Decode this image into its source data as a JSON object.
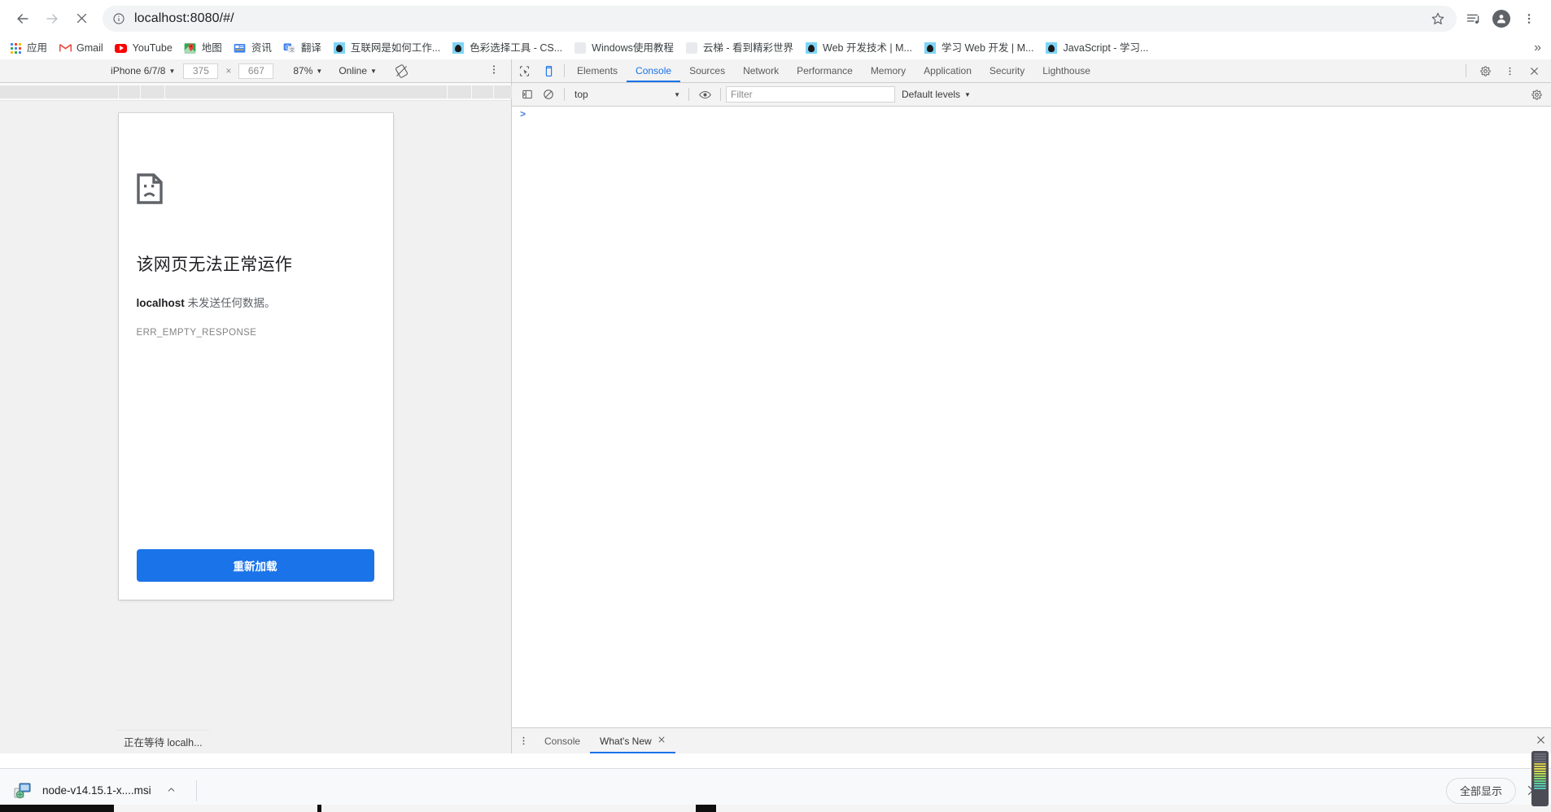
{
  "browser": {
    "nav": {
      "back_icon": "arrow-left-icon",
      "forward_icon": "arrow-right-icon",
      "stop_icon": "close-x-icon"
    },
    "omnibox": {
      "info_icon": "info-circle-icon",
      "url": "localhost:8080/#/",
      "star_icon": "star-outline-icon"
    },
    "toolbar_icons": [
      {
        "name": "media-control-icon"
      },
      {
        "name": "profile-avatar-icon"
      },
      {
        "name": "chrome-menu-kebab-icon"
      }
    ]
  },
  "bookmarks": {
    "apps_label": "应用",
    "overflow_label": "»",
    "items": [
      {
        "label": "Gmail",
        "icon": "gmail-icon"
      },
      {
        "label": "YouTube",
        "icon": "youtube-icon"
      },
      {
        "label": "地图",
        "icon": "google-maps-icon"
      },
      {
        "label": "资讯",
        "icon": "google-news-icon"
      },
      {
        "label": "翻译",
        "icon": "google-translate-icon"
      },
      {
        "label": "互联网是如何工作...",
        "icon": "mdn-icon"
      },
      {
        "label": "色彩选择工具 - CS...",
        "icon": "mdn-icon"
      },
      {
        "label": "Windows使用教程",
        "icon": "generic-page-icon"
      },
      {
        "label": "云梯 - 看到精彩世界",
        "icon": "generic-page-icon"
      },
      {
        "label": "Web 开发技术 | M...",
        "icon": "mdn-icon"
      },
      {
        "label": "学习 Web 开发 | M...",
        "icon": "mdn-icon"
      },
      {
        "label": "JavaScript - 学习...",
        "icon": "mdn-icon"
      }
    ]
  },
  "device_toolbar": {
    "device_name": "iPhone 6/7/8",
    "width": "375",
    "x_label": "×",
    "height": "667",
    "zoom": "87%",
    "throttling": "Online",
    "rotate_icon": "rotate-device-icon",
    "kebab_icon": "more-options-kebab-icon"
  },
  "error_page": {
    "icon": "sad-document-icon",
    "title": "该网页无法正常运作",
    "host": "localhost",
    "message_rest": " 未发送任何数据。",
    "error_code": "ERR_EMPTY_RESPONSE",
    "reload_button": "重新加载",
    "status_bubble": "正在等待 localh..."
  },
  "devtools": {
    "inspect_icon": "inspect-cursor-icon",
    "device_toggle_icon": "device-toolbar-icon",
    "tabs": [
      {
        "label": "Elements",
        "selected": false
      },
      {
        "label": "Console",
        "selected": true
      },
      {
        "label": "Sources",
        "selected": false
      },
      {
        "label": "Network",
        "selected": false
      },
      {
        "label": "Performance",
        "selected": false
      },
      {
        "label": "Memory",
        "selected": false
      },
      {
        "label": "Application",
        "selected": false
      },
      {
        "label": "Security",
        "selected": false
      },
      {
        "label": "Lighthouse",
        "selected": false
      }
    ],
    "right_icons": [
      {
        "name": "settings-gear-icon"
      },
      {
        "name": "devtools-kebab-icon"
      },
      {
        "name": "devtools-close-icon"
      }
    ],
    "console_toolbar": {
      "sidebar_icon": "console-sidebar-icon",
      "clear_icon": "clear-console-icon",
      "context": "top",
      "live_expression_icon": "eye-icon",
      "filter_placeholder": "Filter",
      "levels": "Default levels",
      "gear_icon": "console-settings-gear-icon"
    },
    "prompt": ">",
    "drawer": {
      "kebab_icon": "drawer-kebab-icon",
      "tabs": [
        {
          "label": "Console",
          "selected": false,
          "closable": false
        },
        {
          "label": "What's New",
          "selected": true,
          "closable": true
        }
      ],
      "close_icon": "drawer-close-icon"
    }
  },
  "downloads": {
    "file_icon": "msi-installer-icon",
    "file_name": "node-v14.15.1-x....msi",
    "caret_icon": "chevron-up-icon",
    "show_all_label": "全部显示",
    "close_icon": "close-shelf-icon"
  },
  "colors": {
    "accent": "#1a73e8",
    "toolbar_bg": "#f3f3f3",
    "text_primary": "#202124",
    "text_secondary": "#5f6368"
  }
}
